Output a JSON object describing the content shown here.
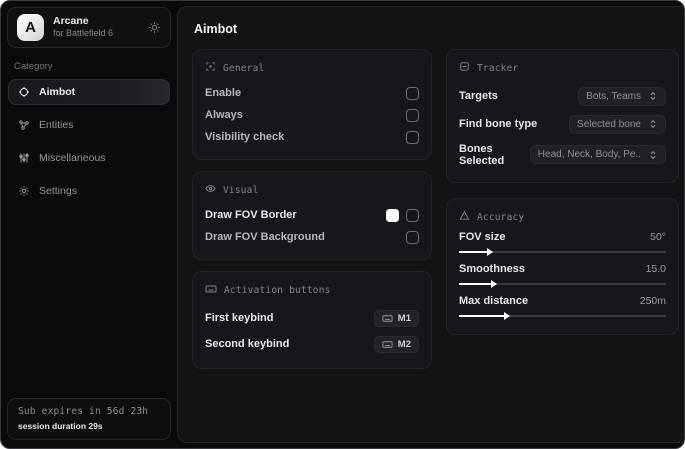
{
  "sidebar": {
    "logo_letter": "A",
    "app_name": "Arcane",
    "app_subtitle": "for Battlefield 6",
    "category_label": "Category",
    "items": [
      {
        "label": "Aimbot",
        "icon": "crosshair-icon",
        "active": true
      },
      {
        "label": "Entities",
        "icon": "entities-icon",
        "active": false
      },
      {
        "label": "Miscellaneous",
        "icon": "sliders-icon",
        "active": false
      },
      {
        "label": "Settings",
        "icon": "gear-icon",
        "active": false
      }
    ],
    "footer": {
      "expiry": "Sub expires in 56d 23h",
      "session": "session duration 29s"
    }
  },
  "main": {
    "title": "Aimbot",
    "general": {
      "title": "General",
      "rows": [
        {
          "label": "Enable",
          "checked": false
        },
        {
          "label": "Always",
          "checked": false
        },
        {
          "label": "Visibility check",
          "checked": false
        }
      ]
    },
    "visual": {
      "title": "Visual",
      "rows": [
        {
          "label": "Draw FOV Border",
          "swatch_color": "#ffffff",
          "checked": false
        },
        {
          "label": "Draw FOV Background",
          "checked": false
        }
      ]
    },
    "activation": {
      "title": "Activation buttons",
      "rows": [
        {
          "label": "First keybind",
          "keybind": "M1"
        },
        {
          "label": "Second keybind",
          "keybind": "M2"
        }
      ]
    },
    "tracker": {
      "title": "Tracker",
      "rows": [
        {
          "label": "Targets",
          "value": "Bots, Teams"
        },
        {
          "label": "Find bone type",
          "value": "Selected bone"
        },
        {
          "label": "Bones Selected",
          "value": "Head, Neck, Body, Pe.."
        }
      ]
    },
    "accuracy": {
      "title": "Accuracy",
      "rows": [
        {
          "label": "FOV size",
          "value": "50°",
          "fill_pct": 14
        },
        {
          "label": "Smoothness",
          "value": "15.0",
          "fill_pct": 16
        },
        {
          "label": "Max distance",
          "value": "250m",
          "fill_pct": 22
        }
      ]
    }
  },
  "colors": {
    "window_bg": "#0a0a0c",
    "panel_bg": "#131316",
    "card_bg": "#17171b",
    "slider_fill": "#ffffff",
    "fov_border_swatch": "#ffffff"
  }
}
